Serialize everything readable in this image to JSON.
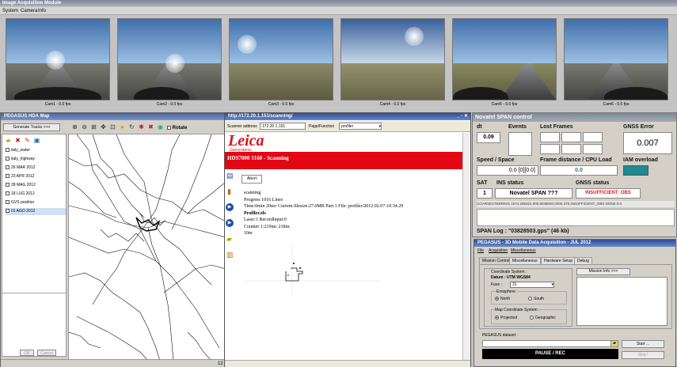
{
  "top_window": {
    "title": "Image Acquisition Module",
    "menu": [
      "System",
      "Camera",
      "Info"
    ]
  },
  "cameras": [
    {
      "label": "Cam1 - 0.0 fps"
    },
    {
      "label": "Cam2 - 0.0 fps"
    },
    {
      "label": "Cam3 - 0.0 fps"
    },
    {
      "label": "Cam4 - 0.0 fps"
    },
    {
      "label": "Cam5 - 0.0 fps"
    },
    {
      "label": "Cam6 - 0.0 fps"
    }
  ],
  "map_window": {
    "title": "PEGASUS HDA Map",
    "generate_button": "Generate Tracks >>>",
    "rotate_label": "Rotate",
    "layers": [
      "italy_water",
      "italy_highway",
      "26 MAR 2012",
      "23 APR 2012",
      "28 MAG 2012",
      "18 LUG 2012",
      "GVS position",
      "01 AGO 2012"
    ],
    "ok": "OK",
    "cancel": "Cancel",
    "status_value": "12"
  },
  "browser": {
    "title": "http://172.20.1.151/scanning/",
    "scanner_label": "Scanner address",
    "scanner_value": "172.20.1.151",
    "page_label": "Page/Function",
    "page_value": "profiler",
    "logo": "Leica",
    "logo_sub": "Geosystems",
    "banner": "HDS7000 3160 - Scanning",
    "abort": "Abort",
    "status_lines": [
      "scanning",
      "Progress 1016 Lines",
      "Time:0min 20sec Current filesize:27.0MB Part:1 File: profiler/2012.02.07-10.34.29",
      "Profiler.zfs",
      "Laser:1 Recordinput:0",
      "Counter 1:219inc 2:0inc",
      "10m"
    ]
  },
  "novatel": {
    "title": "Novatel SPAN control",
    "dt_label": "dt",
    "dt_value": "0.09",
    "events_label": "Events",
    "lost_label": "Lost Frames",
    "gnss_error_label": "GNSS Error",
    "gnss_error_value": "0.007",
    "speed_label": "Speed / Space",
    "speed_value": "0.0 [0][0.0]",
    "frame_label": "Frame distance / CPU Load",
    "frame_value": "0.0",
    "iam_label": "IAM overload",
    "sat_label": "SAT",
    "sat_value": "1",
    "ins_label": "INS status",
    "ins_value": "Novatel SPAN ???",
    "gnss_status_label": "GNSS status",
    "gnss_status_value": "INSUFFICIENT_OBS",
    "log_line": "COARSESTEERING.1674.205322.000.6048000.0000.470.INSUFFICIENT_OBS.NONE.0.0",
    "span_log": "SPAN Log : \"03828503.gps\"  (46 kb)",
    "iam_color": "#1f8a8f",
    "gnss_status_color": "#e8141b"
  },
  "pegasus": {
    "title": "PEGASUS - 3D Mobile Data Acquisition - JUL 2012",
    "menu": [
      "File",
      "Acquisition",
      "Miscellaneous"
    ],
    "tabs": [
      "Mission Control",
      "Miscellaneous",
      "Hardware Setup",
      "Debug"
    ],
    "coord_label": "Coordinate System :",
    "datum": "Datum : UTM WGS84",
    "fuse_label": "Fuse :",
    "fuse_value": "31",
    "emisphere_label": "Emisphere :",
    "north": "North",
    "south": "South",
    "map_coord_label": "Map Coordinate System :",
    "projected": "Projected",
    "geographic": "Geographic",
    "mission_info": "Mission Info >>>",
    "dataset_label": "PEGASUS dataset :",
    "start": "Start ...",
    "stop": "Stop !",
    "pause": "PAUSE / REC"
  }
}
